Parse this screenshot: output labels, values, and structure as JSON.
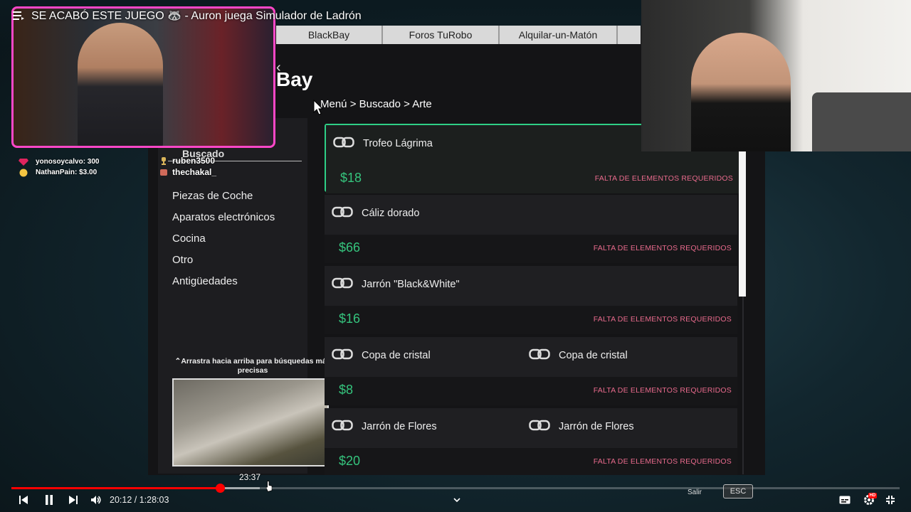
{
  "video": {
    "title": "SE ACABÓ ESTE JUEGO 🦝 - Auron juega Simulador de Ladrón",
    "current_time": "20:12 / 1:28:03",
    "hover_time": "23:37",
    "progress_fraction": 0.235,
    "buffer_fraction": 0.28,
    "hint_exit": "Salir",
    "esc_key": "ESC",
    "hd_badge": "HD"
  },
  "game": {
    "tabs": [
      "BlackBay",
      "Foros TuRobo",
      "Alquilar-un-Matón",
      ""
    ],
    "site_title": "Bay",
    "breadcrumb": "Menú > Buscado > Arte",
    "sidebar": {
      "heading": "Buscado",
      "categories": [
        "Piezas de Coche",
        "Aparatos electrónicos",
        "Cocina",
        "Otro",
        "Antigüedades"
      ],
      "swipe_hint": "⌃Arrastra hacia arriba para búsquedas más precisas"
    },
    "listings": [
      {
        "names": [
          "Trofeo Lágrima"
        ],
        "price": "$18",
        "status": "FALTA DE ELEMENTOS REQUERIDOS",
        "selected": true
      },
      {
        "names": [
          "Cáliz dorado"
        ],
        "price": "$66",
        "status": "FALTA DE ELEMENTOS REQUERIDOS"
      },
      {
        "names": [
          "Jarrón \"Black&White\""
        ],
        "price": "$16",
        "status": "FALTA DE ELEMENTOS REQUERIDOS"
      },
      {
        "names": [
          "Copa de cristal",
          "Copa de cristal"
        ],
        "price": "$8",
        "status": "FALTA DE ELEMENTOS REQUERIDOS"
      },
      {
        "names": [
          "Jarrón de Flores",
          "Jarrón de Flores"
        ],
        "price": "$20",
        "status": "FALTA DE ELEMENTOS REQUERIDOS"
      }
    ]
  },
  "overlay": {
    "donations": [
      {
        "text": "yonosoycalvo: 300",
        "icon": "gem-icon",
        "color": "#e0245e"
      },
      {
        "text": "NathanPain: $3.00",
        "icon": "coin-icon",
        "color": "#f5c542"
      }
    ],
    "chat": [
      {
        "user": "ruben3500",
        "icon": "trophy-icon"
      },
      {
        "user": "thechakal_",
        "icon": "badge-icon"
      }
    ]
  },
  "colors": {
    "accent_green": "#2ecf86",
    "price_green": "#35c47d",
    "status_pink": "#e86a8c",
    "cam_border": "#ff47c8",
    "progress_red": "#ff0000"
  }
}
